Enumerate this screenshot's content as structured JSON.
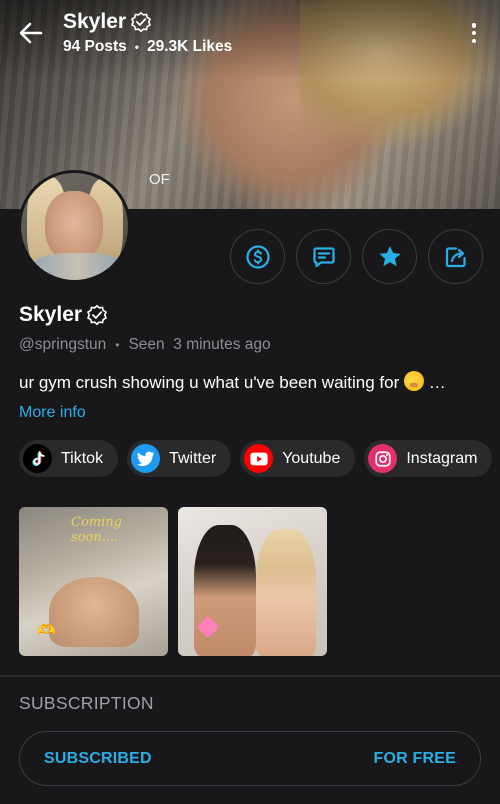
{
  "header": {
    "name": "Skyler",
    "posts": "94 Posts",
    "likes": "29.3K Likes",
    "separator": "•",
    "cover_label": "OF"
  },
  "profile": {
    "name": "Skyler",
    "handle": "@springstun",
    "separator": "•",
    "seen": "Seen  3 minutes ago",
    "bio": "ur gym crush showing u what u've been waiting for",
    "bio_ellipsis": "…",
    "more_info": "More info"
  },
  "actions": [
    {
      "icon": "dollar-icon"
    },
    {
      "icon": "message-icon"
    },
    {
      "icon": "star-icon"
    },
    {
      "icon": "share-icon"
    }
  ],
  "socials": [
    {
      "label": "Tiktok",
      "icon": "tiktok-icon",
      "color": "#000000"
    },
    {
      "label": "Twitter",
      "icon": "twitter-icon",
      "color": "#1d9bf0"
    },
    {
      "label": "Youtube",
      "icon": "youtube-icon",
      "color": "#ff0000"
    },
    {
      "label": "Instagram",
      "icon": "instagram-icon",
      "color": "#e1306c"
    }
  ],
  "media": {
    "thumb1_overlay": "Coming soon....",
    "thumb1_sticker": "🫶"
  },
  "subscription": {
    "title": "SUBSCRIPTION",
    "status": "SUBSCRIBED",
    "price": "FOR FREE"
  },
  "colors": {
    "accent": "#2aaee6",
    "background": "#18181a",
    "chip": "#2a2a2d"
  }
}
